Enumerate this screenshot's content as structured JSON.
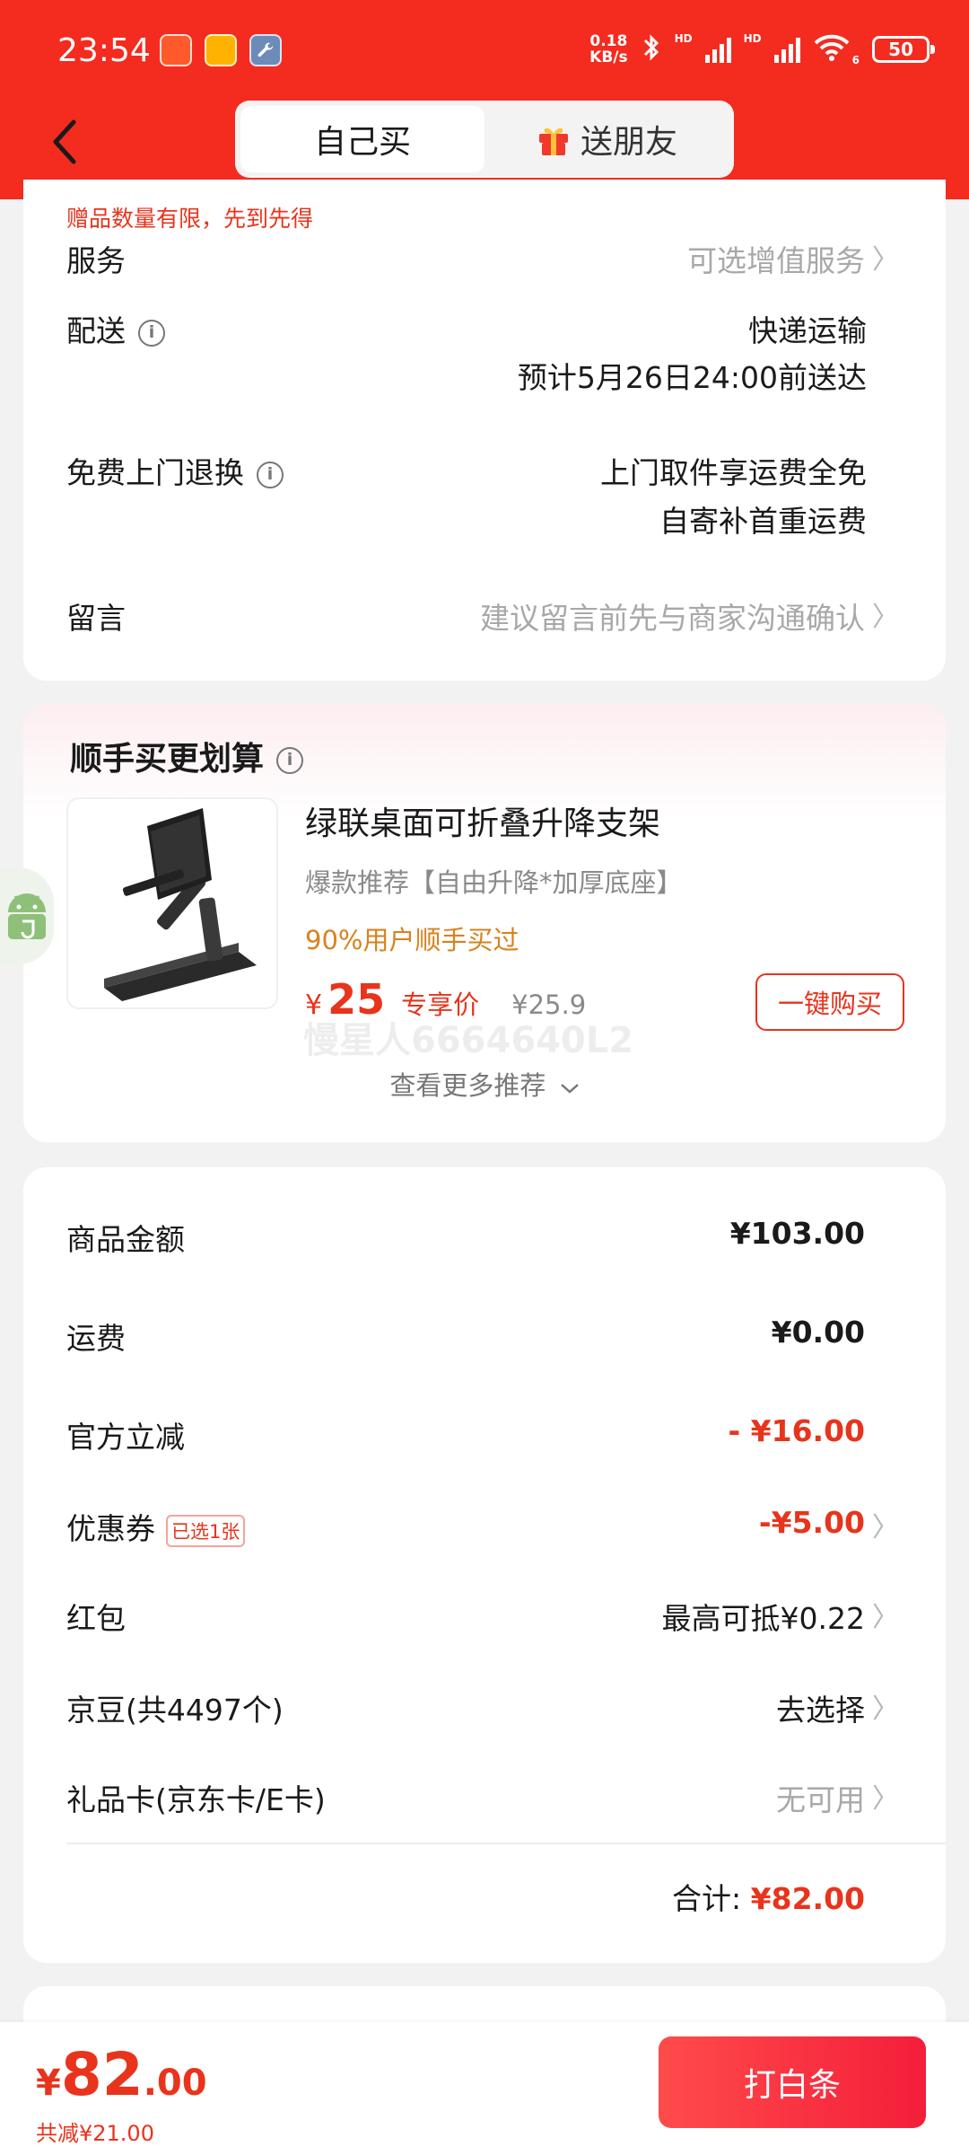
{
  "status_bar": {
    "time": "23:54",
    "net_speed_value": "0.18",
    "net_speed_unit": "KB/s",
    "hd_label": "HD",
    "wifi_label": "6",
    "battery": "50"
  },
  "header": {
    "tab_self": "自己买",
    "tab_friend": "送朋友"
  },
  "order_info": {
    "gift_note": "赠品数量有限，先到先得",
    "service_label": "服务",
    "service_value": "可选增值服务",
    "delivery_label": "配送",
    "delivery_method": "快递运输",
    "delivery_eta": "预计5月26日24:00前送达",
    "return_label": "免费上门退换",
    "return_line1": "上门取件享运费全免",
    "return_line2": "自寄补首重运费",
    "message_label": "留言",
    "message_placeholder": "建议留言前先与商家沟通确认"
  },
  "recommend": {
    "title": "顺手买更划算",
    "product_title": "绿联桌面可折叠升降支架",
    "product_subtitle": "爆款推荐【自由升降*加厚底座】",
    "product_users": "90%用户顺手买过",
    "price_symbol": "¥",
    "price": "25",
    "price_tag": "专享价",
    "original_price": "¥25.9",
    "buy_button": "一键购买",
    "watermark": "慢星人6664640L2",
    "more_label": "查看更多推荐"
  },
  "price_detail": {
    "goods_label": "商品金额",
    "goods_value": "¥103.00",
    "shipping_label": "运费",
    "shipping_value": "¥0.00",
    "discount_label": "官方立减",
    "discount_value": "- ¥16.00",
    "coupon_label": "优惠券",
    "coupon_badge": "已选1张",
    "coupon_value": "-¥5.00",
    "redpacket_label": "红包",
    "redpacket_value": "最高可抵¥0.22",
    "beans_label": "京豆(共4497个)",
    "beans_value": "去选择",
    "giftcard_label": "礼品卡(京东卡/E卡)",
    "giftcard_value": "无可用",
    "total_label": "合计:",
    "total_value": "¥82.00"
  },
  "bottom_bar": {
    "yen": "¥",
    "price_int": "82",
    "price_dec": ".00",
    "saved": "共减¥21.00",
    "pay_button": "打白条"
  },
  "colors": {
    "header_red": "#f42b1f",
    "accent_red": "#e8341c",
    "orange": "#d9821d"
  }
}
